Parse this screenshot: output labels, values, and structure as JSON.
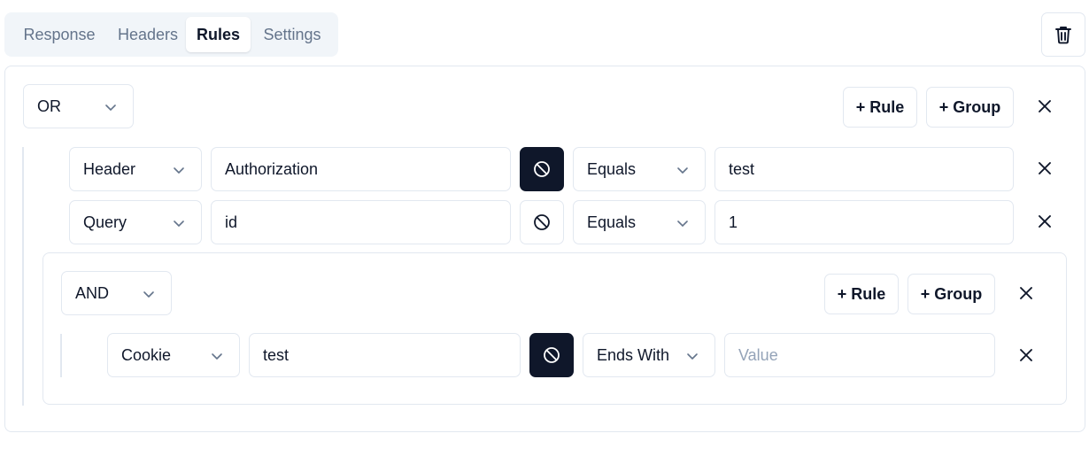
{
  "tabs": [
    {
      "label": "Response"
    },
    {
      "label": "Headers"
    },
    {
      "label": "Rules"
    },
    {
      "label": "Settings"
    }
  ],
  "active_tab": "Rules",
  "root_group": {
    "operator": "OR",
    "add_rule_label": "+ Rule",
    "add_group_label": "+ Group",
    "rules": [
      {
        "source": "Header",
        "key": "Authorization",
        "negated": true,
        "condition": "Equals",
        "value": "test"
      },
      {
        "source": "Query",
        "key": "id",
        "negated": false,
        "condition": "Equals",
        "value": "1"
      }
    ]
  },
  "nested_group": {
    "operator": "AND",
    "add_rule_label": "+ Rule",
    "add_group_label": "+ Group",
    "rules": [
      {
        "source": "Cookie",
        "key": "test",
        "negated": true,
        "condition": "Ends With",
        "value": "",
        "value_placeholder": "Value"
      }
    ]
  },
  "icons": {
    "delete": "trash-icon",
    "chevron": "chevron-down-icon",
    "negate": "ban-icon",
    "remove": "close-icon"
  },
  "colors": {
    "accent_dark": "#0f172a",
    "border": "#e2e8f0",
    "muted_text": "#64748b",
    "placeholder": "#94a3b8",
    "tab_bar_bg": "#f1f5f9"
  }
}
